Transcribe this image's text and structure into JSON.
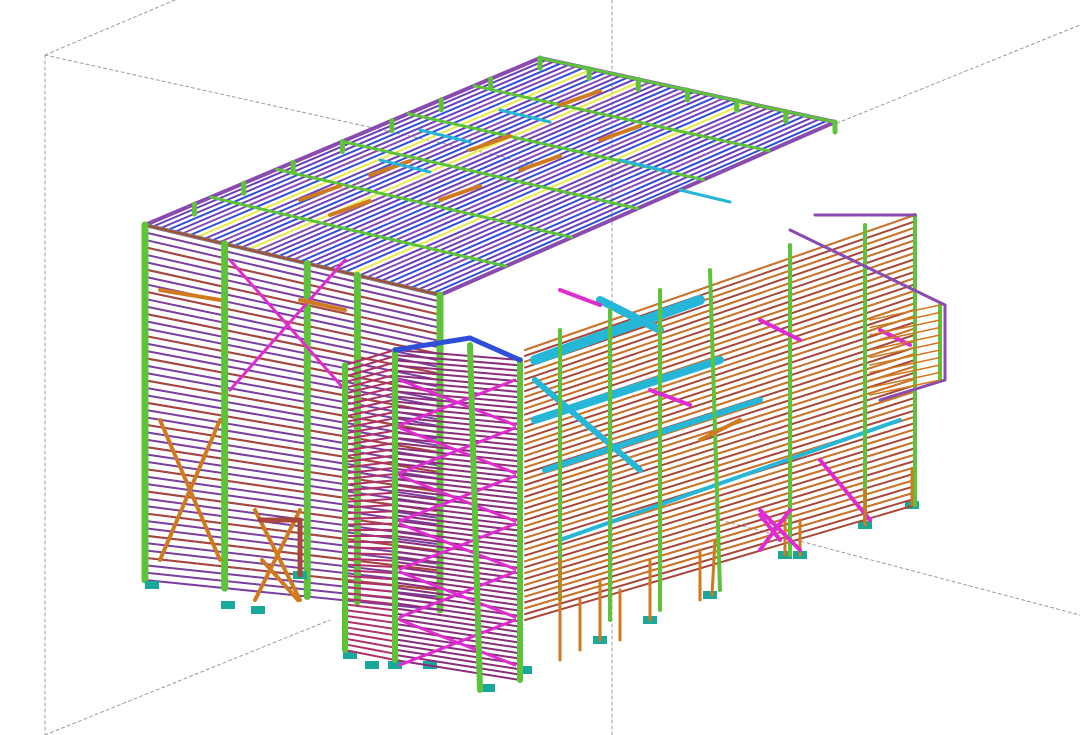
{
  "viewport": {
    "background": "#ffffff",
    "grid_line_color": "#9c9c9c"
  },
  "model": {
    "description_colors": {
      "column_green": "#5dc43a",
      "purple": "#8a4bb0",
      "magenta": "#e02bd0",
      "blue": "#2f4fd8",
      "cyan": "#25b6d8",
      "orange": "#d07a1f",
      "brown_red": "#a8473a",
      "yellow": "#e8e84a",
      "base_teal": "#1aa89a"
    }
  }
}
